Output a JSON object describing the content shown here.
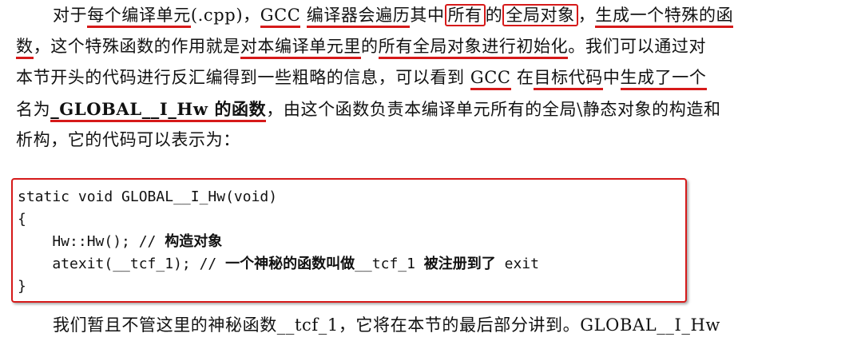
{
  "paragraph1": {
    "line1": [
      "对于",
      "每个编译单元",
      "(.cpp)，",
      "GCC",
      " ",
      "编译器会",
      "遍历",
      "其中",
      "所有",
      "的",
      "全局对象",
      "，",
      "生成一个",
      "特殊的函"
    ],
    "line2": [
      "数",
      "，这个特殊函数的作用就是",
      "对本编译单元里",
      "的",
      "所有全局对象",
      "进行",
      "初始化",
      "。我们可以通过对"
    ],
    "line3": [
      "本节开头的代码进行反汇编得到一些粗略的信息，可以看到 ",
      "GCC",
      " 在",
      "目标代码",
      "中",
      "生成了一个"
    ],
    "line4": [
      "名为",
      "_GLOBAL__I_Hw 的函数",
      "，由这个函数负责本编译单元所有的全局\\静态对象的构造和"
    ],
    "line5": [
      "析构，它的代码可以表示为："
    ]
  },
  "code": {
    "line1": "static void GLOBAL__I_Hw(void)",
    "line2": "{",
    "line3_code": "    Hw::Hw(); // ",
    "line3_comment": "构造对象",
    "line4_code": "    atexit(__tcf_1); // ",
    "line4_comment": "一个神秘的函数叫做",
    "line4_code2": "__tcf_1 ",
    "line4_comment2": "被注册到了",
    "line4_code3": " exit",
    "line5": "}"
  },
  "paragraph2": {
    "line1": "我们暂且不管这里的神秘函数__tcf_1，它将在本节的最后部分讲到。GLOBAL__I_Hw"
  },
  "colors": {
    "annotation": "#d61a1a"
  }
}
